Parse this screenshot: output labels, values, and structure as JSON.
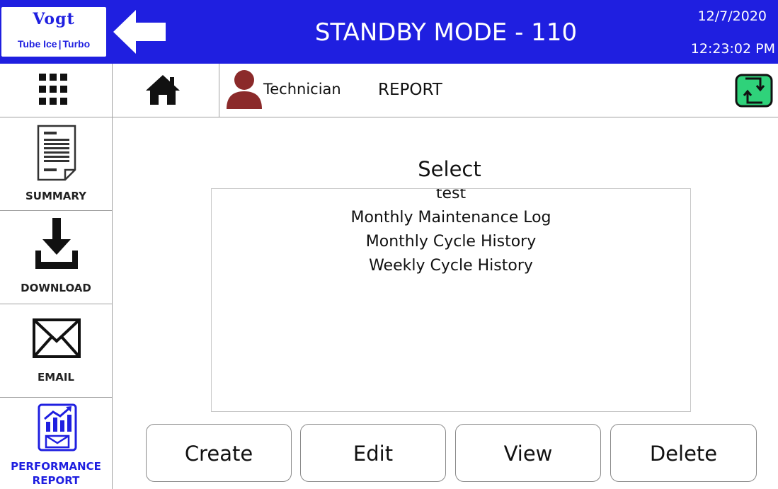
{
  "header": {
    "logo_brand": "Vogt",
    "logo_sub_left": "Tube Ice",
    "logo_sub_right": "Turbo",
    "title": "STANDBY MODE - 110",
    "date": "12/7/2020",
    "time": "12:23:02 PM"
  },
  "navbar": {
    "user_role": "Technician",
    "page_name": "REPORT"
  },
  "sidebar": {
    "items": [
      {
        "label": "SUMMARY",
        "icon": "document-icon"
      },
      {
        "label": "DOWNLOAD",
        "icon": "download-icon"
      },
      {
        "label": "EMAIL",
        "icon": "envelope-icon"
      },
      {
        "label_line1": "PERFORMANCE",
        "label_line2": "REPORT",
        "icon": "performance-report-icon",
        "active": true
      }
    ]
  },
  "main": {
    "select_title": "Select",
    "list_items": [
      "test",
      "Monthly Maintenance Log",
      "Monthly Cycle History",
      "Weekly Cycle History"
    ]
  },
  "actions": {
    "create": "Create",
    "edit": "Edit",
    "view": "View",
    "delete": "Delete"
  },
  "colors": {
    "header_bg": "#1f1fe0",
    "user_icon": "#8b2a2a",
    "switch_icon": "#2fd27a",
    "active_sidebar": "#1f1fe0"
  }
}
